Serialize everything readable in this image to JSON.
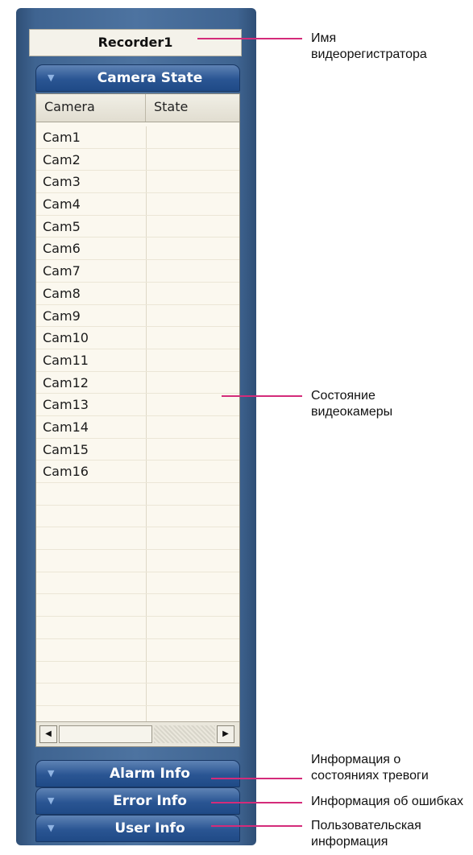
{
  "recorder_name": "Recorder1",
  "sections": {
    "camera_state": "Camera State",
    "alarm_info": "Alarm Info",
    "error_info": "Error Info",
    "user_info": "User Info"
  },
  "table": {
    "columns": [
      "Camera",
      "State"
    ],
    "cameras": [
      "Cam1",
      "Cam2",
      "Cam3",
      "Cam4",
      "Cam5",
      "Cam6",
      "Cam7",
      "Cam8",
      "Cam9",
      "Cam10",
      "Cam11",
      "Cam12",
      "Cam13",
      "Cam14",
      "Cam15",
      "Cam16"
    ]
  },
  "annotations": {
    "recorder_name": [
      "Имя",
      "видеорегистратора"
    ],
    "camera_state": [
      "Состояние",
      "видеокамеры"
    ],
    "alarm_info": [
      "Информация о",
      "состояниях тревоги"
    ],
    "error_info": [
      "Информация об ошибках"
    ],
    "user_info": [
      "Пользовательская",
      "информация"
    ]
  },
  "colors": {
    "panel": "#3f6491",
    "section_bar": "#2a5593",
    "annotation_line": "#d42b7a"
  },
  "icons": {
    "collapse": "chevron-down-icon",
    "scroll_left": "triangle-left-icon",
    "scroll_right": "triangle-right-icon"
  }
}
